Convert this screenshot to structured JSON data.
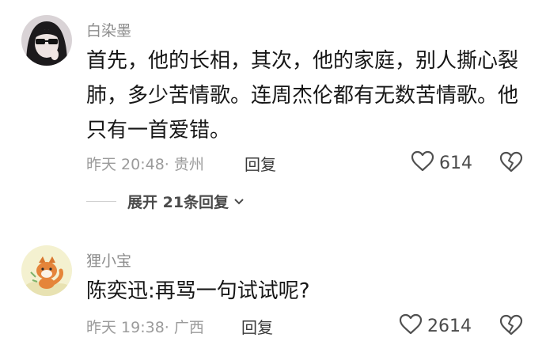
{
  "comments": [
    {
      "username": "白染墨",
      "content": "首先，他的长相，其次，他的家庭，别人撕心裂肺，多少苦情歌。连周杰伦都有无数苦情歌。他只有一首爱错。",
      "time": "昨天 20:48",
      "location": "· 贵州",
      "reply_label": "回复",
      "likes": "614",
      "expand_label": "展开 21条回复"
    },
    {
      "username": "狸小宝",
      "content": "陈奕迅:再骂一句试试呢?",
      "time": "昨天 19:38",
      "location": "· 广西",
      "reply_label": "回复",
      "likes": "2614"
    }
  ],
  "icons": {
    "like": "heart-outline-icon",
    "dislike": "broken-heart-icon",
    "expand": "chevron-down-icon"
  },
  "colors": {
    "username": "#8d8d8d",
    "meta": "#9b9b9b",
    "text": "#161616"
  }
}
